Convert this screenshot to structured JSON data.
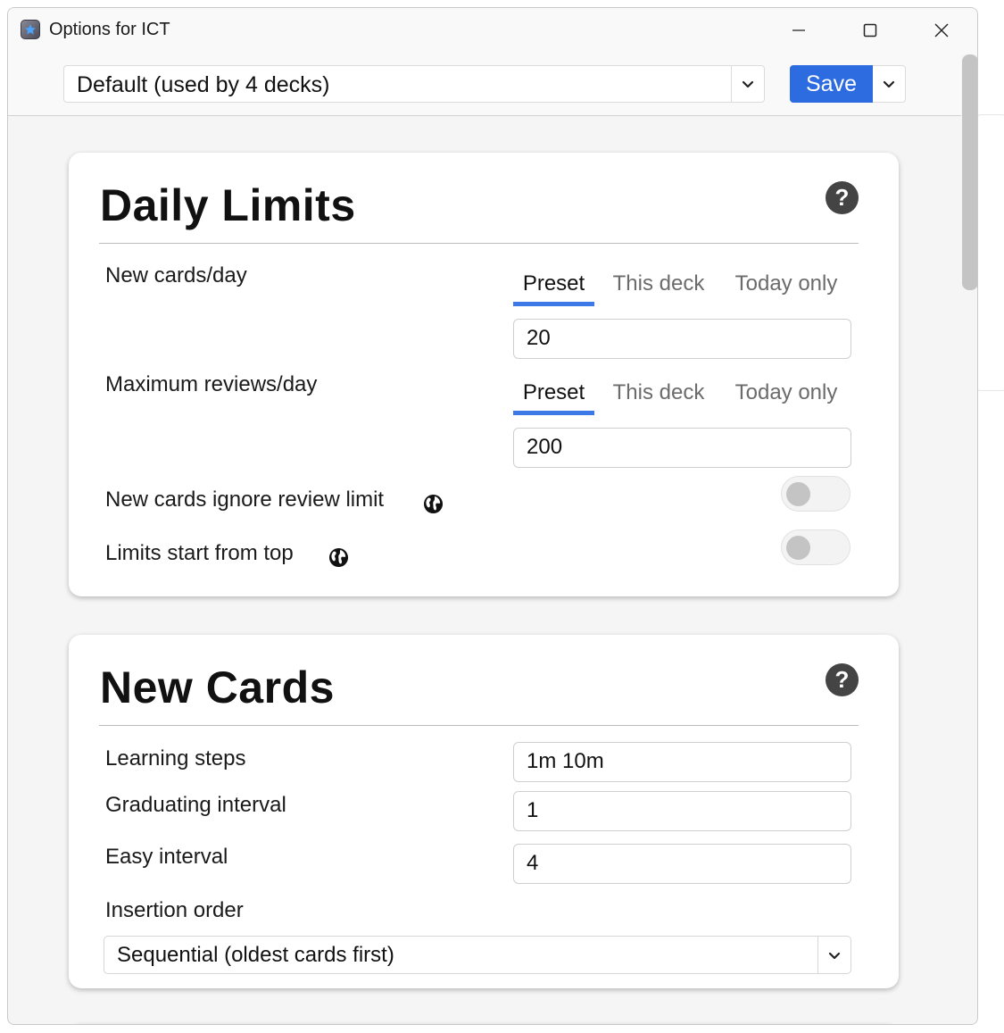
{
  "window": {
    "title": "Options for ICT",
    "minimize_label": "Minimize",
    "maximize_label": "Maximize",
    "close_label": "Close"
  },
  "toolbar": {
    "preset_value": "Default (used by 4 decks)",
    "save_label": "Save"
  },
  "daily_limits": {
    "title": "Daily Limits",
    "help_glyph": "?",
    "new_cards": {
      "label": "New cards/day",
      "tabs": [
        "Preset",
        "This deck",
        "Today only"
      ],
      "active_tab": "Preset",
      "value": "20"
    },
    "max_reviews": {
      "label": "Maximum reviews/day",
      "tabs": [
        "Preset",
        "This deck",
        "Today only"
      ],
      "active_tab": "Preset",
      "value": "200"
    },
    "ignore_review_limit": {
      "label": "New cards ignore review limit",
      "enabled": false
    },
    "limits_start_top": {
      "label": "Limits start from top",
      "enabled": false
    }
  },
  "new_cards": {
    "title": "New Cards",
    "help_glyph": "?",
    "learning_steps": {
      "label": "Learning steps",
      "value": "1m 10m"
    },
    "graduating_interval": {
      "label": "Graduating interval",
      "value": "1"
    },
    "easy_interval": {
      "label": "Easy interval",
      "value": "4"
    },
    "insertion_order": {
      "label": "Insertion order",
      "value": "Sequential (oldest cards first)"
    }
  },
  "colors": {
    "accent": "#2c6be0",
    "tab_underline": "#3c78e6",
    "help_icon": "#444444"
  }
}
